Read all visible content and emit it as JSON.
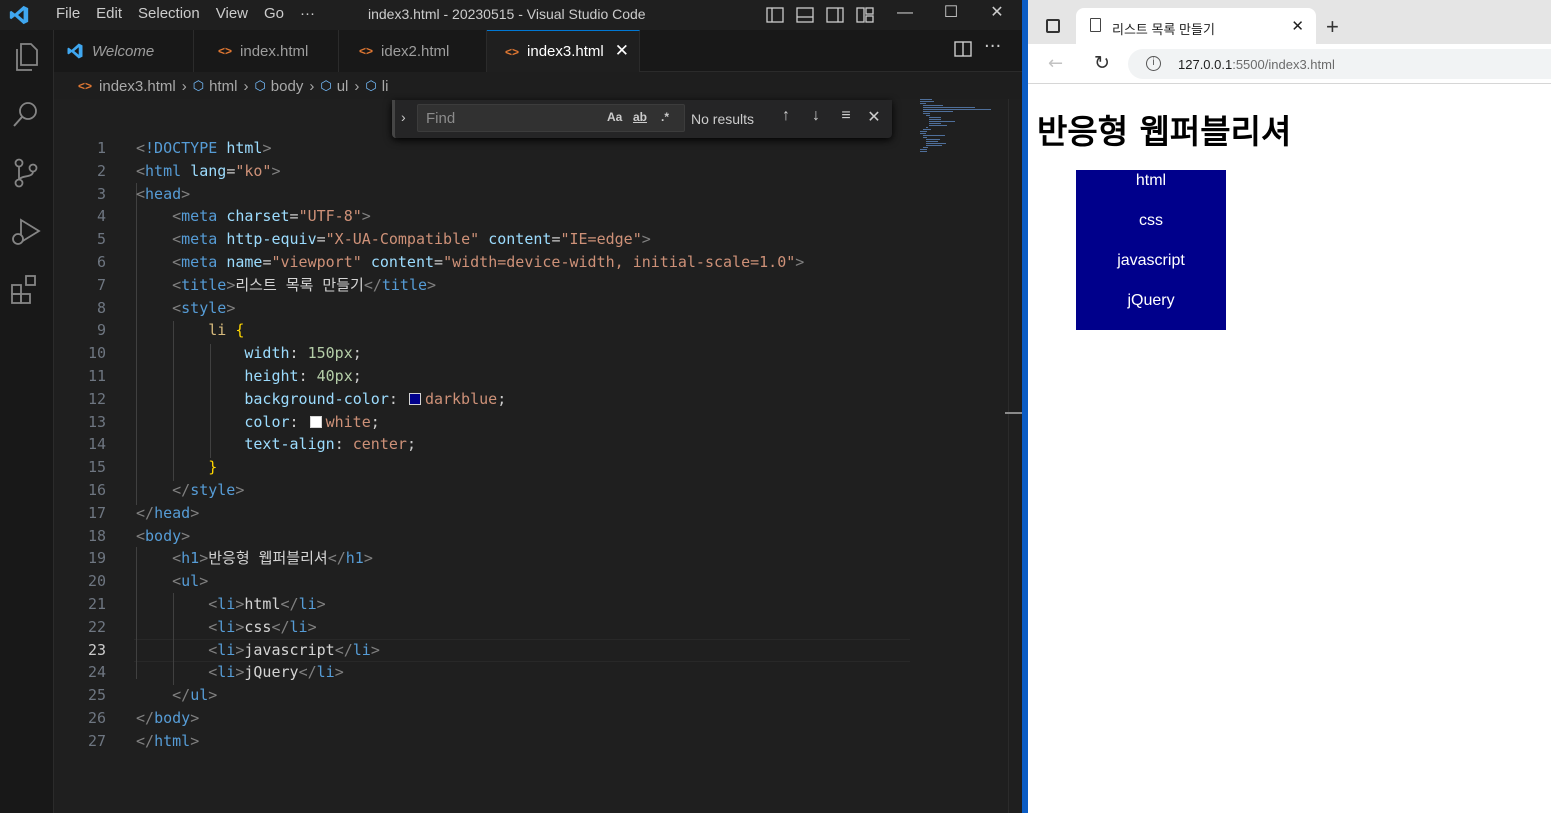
{
  "vscode": {
    "menu": [
      "File",
      "Edit",
      "Selection",
      "View",
      "Go",
      "···"
    ],
    "window_title": "index3.html - 20230515 - Visual Studio Code",
    "window_controls": {
      "minimize": "—",
      "maximize": "☐",
      "close": "✕"
    },
    "tabs": [
      {
        "label": "Welcome",
        "icon": "vscode-logo-icon",
        "active": false,
        "italic": true
      },
      {
        "label": "index.html",
        "icon": "html-file-icon",
        "active": false
      },
      {
        "label": "idex2.html",
        "icon": "html-file-icon",
        "active": false
      },
      {
        "label": "index3.html",
        "icon": "html-file-icon",
        "active": true
      }
    ],
    "breadcrumb": [
      "index3.html",
      "html",
      "body",
      "ul",
      "li"
    ],
    "find": {
      "placeholder": "Find",
      "opt_case": "Aa",
      "opt_word": "ab",
      "opt_regex": ".*",
      "status": "No results"
    },
    "current_line": 23,
    "code_lines": [
      "<!DOCTYPE html>",
      "<html lang=\"ko\">",
      "<head>",
      "    <meta charset=\"UTF-8\">",
      "    <meta http-equiv=\"X-UA-Compatible\" content=\"IE=edge\">",
      "    <meta name=\"viewport\" content=\"width=device-width, initial-scale=1.0\">",
      "    <title>리스트 목록 만들기</title>",
      "    <style>",
      "        li {",
      "            width: 150px;",
      "            height: 40px;",
      "            background-color: darkblue;",
      "            color: white;",
      "            text-align: center;",
      "        }",
      "    </style>",
      "</head>",
      "<body>",
      "    <h1>반응형 웹퍼블리셔</h1>",
      "    <ul>",
      "        <li>html</li>",
      "        <li>css</li>",
      "        <li>javascript</li>",
      "        <li>jQuery</li>",
      "    </ul>",
      "</body>",
      "</html>"
    ],
    "colors": {
      "tag": "#569cd6",
      "attr": "#9cdcfe",
      "string": "#ce9178",
      "accent": "#0078d4"
    }
  },
  "browser": {
    "tab_title": "리스트 목록 만들기",
    "new_tab": "+",
    "url_host": "127.0.0.1",
    "url_path": ":5500/index3.html",
    "page": {
      "heading": "반응형 웹퍼블리셔",
      "items": [
        "html",
        "css",
        "javascript",
        "jQuery"
      ]
    }
  }
}
